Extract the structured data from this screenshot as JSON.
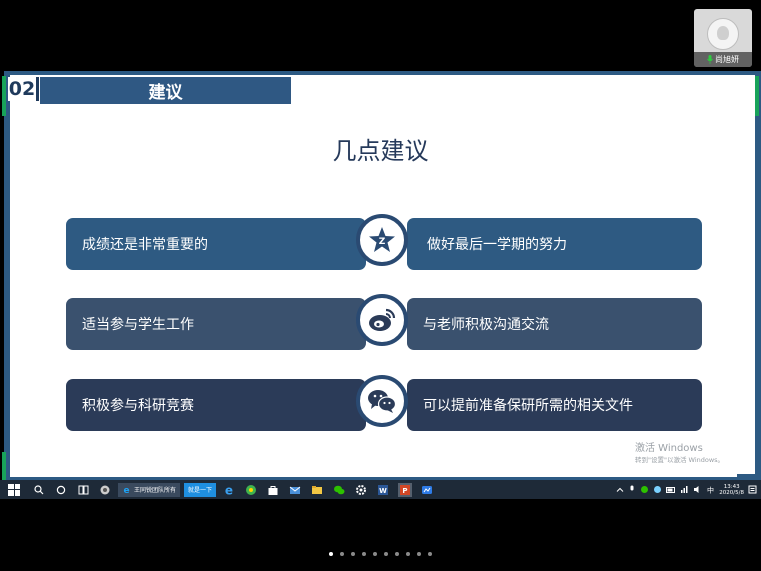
{
  "camera": {
    "participant_name": "尚旭妍",
    "mic_icon": "mic-icon"
  },
  "slide": {
    "section_number": "02",
    "section_title": "建议",
    "heading": "几点建议",
    "rows": [
      {
        "left": "成绩还是非常重要的",
        "icon": "star-badge-icon",
        "right": "做好最后一学期的努力"
      },
      {
        "left": "适当参与学生工作",
        "icon": "weibo-icon",
        "right": "与老师积极沟通交流"
      },
      {
        "left": "积极参与科研竞赛",
        "icon": "wechat-icon",
        "right": "可以提前准备保研所需的相关文件"
      }
    ],
    "watermark_title": "激活 Windows",
    "watermark_sub": "转到\"设置\"以激活 Windows。",
    "colors": {
      "dark_blue": "#2e5a82",
      "slate": "#3a516e",
      "navy": "#2b3b58",
      "green": "#18a35a"
    }
  },
  "taskbar": {
    "ie_window_label": "王同锐团队所有",
    "active_app_label": "就是一下",
    "clock_time": "13:43",
    "clock_date": "2020/5/8"
  },
  "pager": {
    "count": 10,
    "active_index": 0
  }
}
